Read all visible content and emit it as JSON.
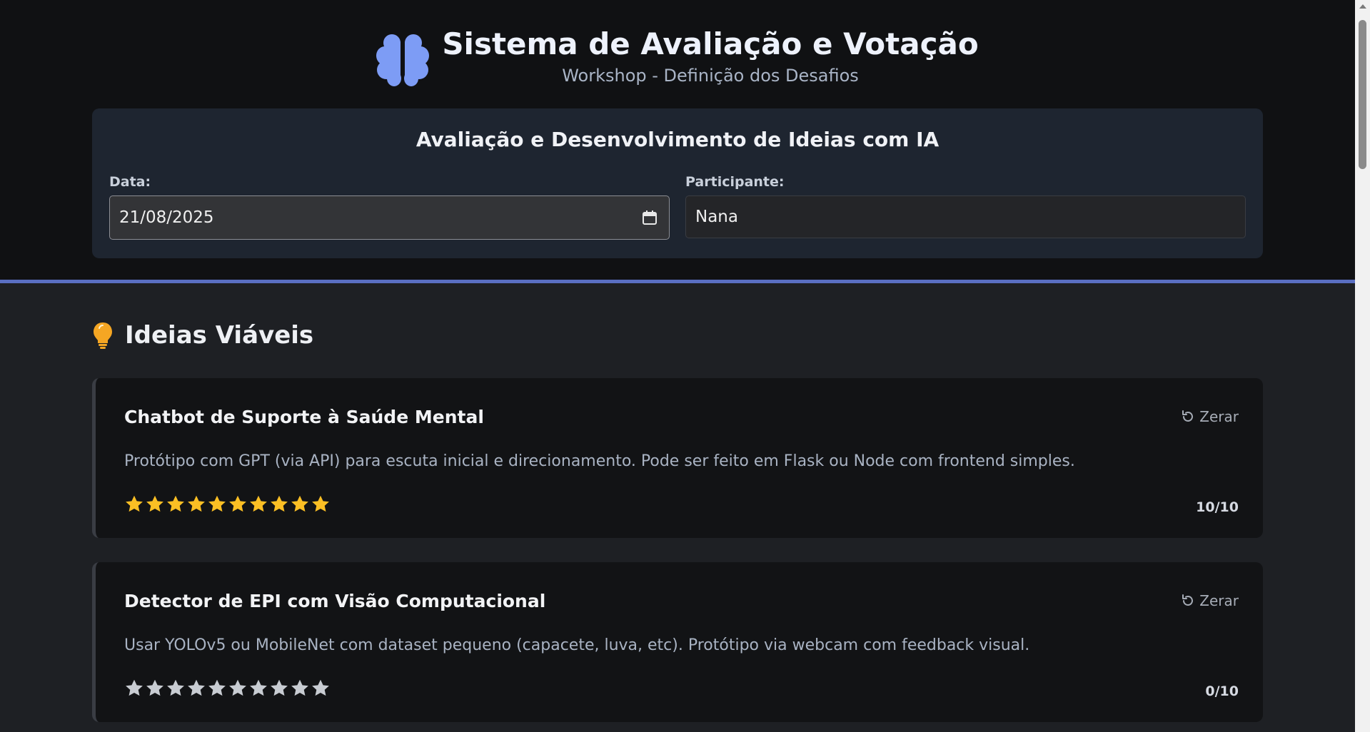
{
  "header": {
    "title": "Sistema de Avaliação e Votação",
    "subtitle": "Workshop - Definição dos Desafios",
    "icon": "brain-icon",
    "brand_color": "#7d9cf5"
  },
  "form": {
    "title": "Avaliação e Desenvolvimento de Ideias com IA",
    "date_label": "Data:",
    "date_value": "21/08/2025",
    "participant_label": "Participante:",
    "participant_value": "Nana"
  },
  "section": {
    "title": "Ideias Viáveis",
    "icon": "lightbulb-icon",
    "icon_color": "#f5a623"
  },
  "ideas": [
    {
      "name": "Chatbot de Suporte à Saúde Mental",
      "description": "Protótipo com GPT (via API) para escuta inicial e direcionamento. Pode ser feito em Flask ou Node com frontend simples.",
      "reset_label": "Zerar",
      "rating": 10,
      "max_rating": 10,
      "score_text": "10/10"
    },
    {
      "name": "Detector de EPI com Visão Computacional",
      "description": "Usar YOLOv5 ou MobileNet com dataset pequeno (capacete, luva, etc). Protótipo via webcam com feedback visual.",
      "reset_label": "Zerar",
      "rating": 0,
      "max_rating": 10,
      "score_text": "0/10"
    }
  ],
  "colors": {
    "star_filled": "#fbbf24",
    "star_empty": "#c8ccd2",
    "accent_line": "#5a6fc2"
  }
}
